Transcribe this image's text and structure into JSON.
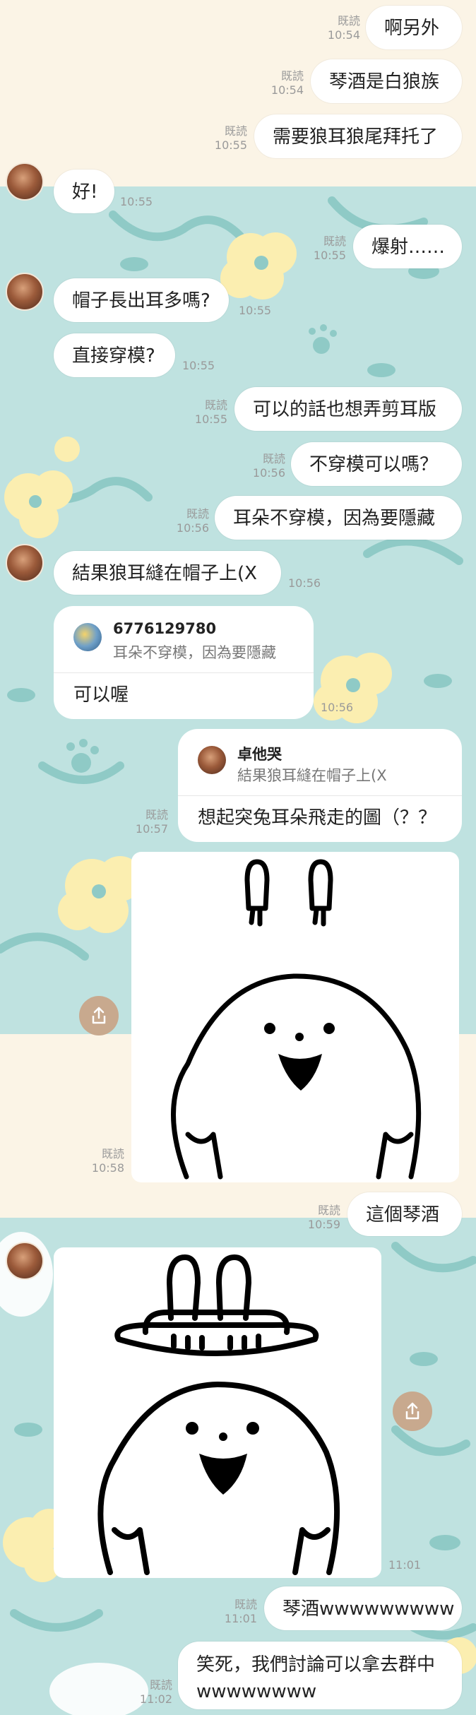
{
  "colors": {
    "chat_background_beige": "#fbf4e6",
    "chat_background_teal": "#bfe2e0",
    "bubble": "#ffffff",
    "meta_text": "#9a9a9a",
    "share_button": "#c8a98e"
  },
  "messages": [
    {
      "text": "啊另外",
      "read": "既読",
      "time": "10:54"
    },
    {
      "text": "琴酒是白狼族",
      "read": "既読",
      "time": "10:54"
    },
    {
      "text": "需要狼耳狼尾拜托了",
      "read": "既読",
      "time": "10:55"
    },
    {
      "text": "好!",
      "time": "10:55"
    },
    {
      "text": "爆射……",
      "read": "既読",
      "time": "10:55"
    },
    {
      "text": "帽子長出耳多嗎?",
      "time": "10:55"
    },
    {
      "text": "直接穿模?",
      "time": "10:55"
    },
    {
      "text": "可以的話也想弄剪耳版",
      "read": "既読",
      "time": "10:55"
    },
    {
      "text": "不穿模可以嗎？",
      "read": "既読",
      "time": "10:56"
    },
    {
      "text": "耳朵不穿模，因為要隱藏",
      "read": "既読",
      "time": "10:56"
    },
    {
      "text": "結果狼耳縫在帽子上(X",
      "time": "10:56"
    },
    {
      "reply_name": "6776129780",
      "reply_text": "耳朵不穿模，因為要隱藏",
      "text": "可以喔",
      "time": "10:56"
    },
    {
      "reply_name": "卓他哭",
      "reply_text": "結果狼耳縫在帽子上(X",
      "text": "想起突兔耳朵飛走的圖（？？",
      "read": "既読",
      "time": "10:57"
    },
    {
      "sticker": "rabbit-ears-flying-sticker",
      "read": "既読",
      "time": "10:58"
    },
    {
      "text": "這個琴酒",
      "read": "既読",
      "time": "10:59"
    },
    {
      "sticker": "rabbit-ears-through-hat-sticker",
      "time": "11:01"
    },
    {
      "text": "琴酒wwwwwwwww",
      "read": "既読",
      "time": "11:01"
    },
    {
      "text": "笑死，我們討論可以拿去群中wwwwwwww",
      "read": "既読",
      "time": "11:02"
    }
  ]
}
